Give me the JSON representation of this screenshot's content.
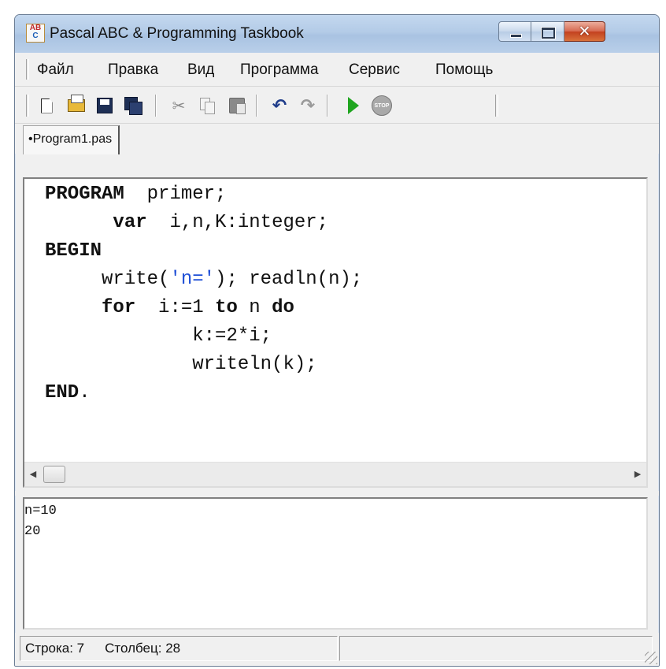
{
  "window": {
    "title": "Pascal ABC & Programming Taskbook",
    "icon_text": "ABC",
    "controls": {
      "minimize": "minimize-icon",
      "maximize": "maximize-icon",
      "close": "close-icon"
    }
  },
  "menu": [
    "Файл",
    "Правка",
    "Вид",
    "Программа",
    "Сервис",
    "Помощь"
  ],
  "toolbar": {
    "icons": [
      "new-file-icon",
      "open-icon",
      "save-icon",
      "save-all-icon",
      "cut-icon",
      "copy-icon",
      "paste-icon",
      "undo-icon",
      "redo-icon",
      "run-icon",
      "stop-icon"
    ],
    "stop_text": "STOP"
  },
  "tab": {
    "label": "•Program1.pas"
  },
  "code": [
    [
      {
        "t": "PROGRAM",
        "k": "kw"
      },
      {
        "t": "  primer;"
      }
    ],
    [
      {
        "t": "      "
      },
      {
        "t": "var",
        "k": "kw"
      },
      {
        "t": "  i,n,K:integer;"
      }
    ],
    [
      {
        "t": "BEGIN",
        "k": "kw"
      }
    ],
    [
      {
        "t": "     write("
      },
      {
        "t": "'n='",
        "k": "str"
      },
      {
        "t": "); readln(n);"
      }
    ],
    [
      {
        "t": "     "
      },
      {
        "t": "for",
        "k": "kw"
      },
      {
        "t": "  i:=1 "
      },
      {
        "t": "to",
        "k": "kw"
      },
      {
        "t": " n "
      },
      {
        "t": "do",
        "k": "kw"
      }
    ],
    [
      {
        "t": "             k:=2*i;"
      }
    ],
    [
      {
        "t": "             writeln(k);"
      }
    ],
    [
      {
        "t": "END",
        "k": "kw"
      },
      {
        "t": "."
      }
    ]
  ],
  "output": [
    "n=10",
    "20"
  ],
  "status": {
    "line": "Строка: 7",
    "column": "Столбец: 28"
  },
  "colors": {
    "string_literal": "#1f4fd6",
    "run_icon": "#1fa51f"
  }
}
